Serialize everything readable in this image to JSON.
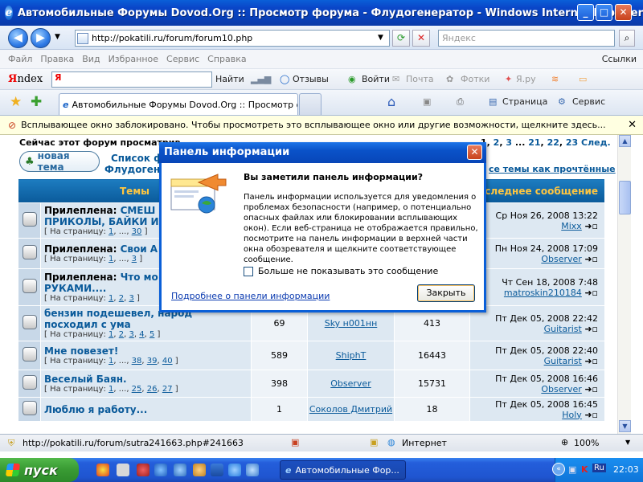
{
  "window": {
    "title": "Автомобильные Форумы Dovod.Org :: Просмотр форума - Флудогенератор - Windows Internet Explorer"
  },
  "address": {
    "url": "http://pokatili.ru/forum/forum10.php",
    "search_placeholder": "Яндекс"
  },
  "menu": {
    "items": [
      "Файл",
      "Правка",
      "Вид",
      "Избранное",
      "Сервис",
      "Справка"
    ],
    "right": "Ссылки"
  },
  "yandex": {
    "logo_a": "Я",
    "logo_b": "ndex",
    "find": "Найти",
    "reviews": "Отзывы",
    "login": "Войти",
    "mail": "Почта",
    "photos": "Фотки",
    "yaru": "Я.ру"
  },
  "favbar": {
    "tab_title": "Автомобильные Форумы Dovod.Org :: Просмотр фо...",
    "page": "Страница",
    "service": "Сервис"
  },
  "infobar": {
    "text": "Всплывающее окно заблокировано. Чтобы просмотреть это всплывающее окно или другие возможности, щелкните здесь..."
  },
  "forum": {
    "currently": "Сейчас этот форум просматрив",
    "pager_pre": "1, ",
    "pager_links": [
      "2",
      "3",
      "...",
      "21",
      "22",
      "23",
      "След."
    ],
    "new_topic": "новая тема",
    "links": [
      "Список ф",
      "Флудоген"
    ],
    "mark_all": "се темы как прочтённые",
    "headers": {
      "topics": "Темы",
      "last": "оследнее сообщение"
    },
    "rows": [
      {
        "prefix": "Прилеплена: ",
        "title": "СМЕШ",
        "title2": "ПРИКОЛЫ, БАЙКИ И Б",
        "pages_label": "На страницу: ",
        "pages": [
          "1",
          "...",
          "30"
        ],
        "replies": "",
        "author": "",
        "views": "",
        "date": "Ср Ноя 26, 2008 13:22",
        "last_user": "Mixx"
      },
      {
        "prefix": "Прилеплена: ",
        "title": "Свои А",
        "title2": "",
        "pages_label": "На страницу: ",
        "pages": [
          "1",
          "...",
          "3"
        ],
        "replies": "",
        "author": "",
        "views": "",
        "date": "Пн Ноя 24, 2008 17:09",
        "last_user": "Observer"
      },
      {
        "prefix": "Прилеплена: ",
        "title": "Что мо",
        "title2": "РУКАМИ....",
        "pages_label": "На страницу: ",
        "pages": [
          "1",
          "2",
          "3"
        ],
        "replies": "",
        "author": "",
        "views": "",
        "date": "Чт Сен 18, 2008 7:48",
        "last_user": "matroskin210184"
      },
      {
        "prefix": "",
        "title": "бензин подешевел, народ",
        "title2": "посходил с ума",
        "pages_label": "На страницу: ",
        "pages": [
          "1",
          "2",
          "3",
          "4",
          "5"
        ],
        "replies": "69",
        "author": "Sky н001нн",
        "views": "413",
        "date": "Пт Дек 05, 2008 22:42",
        "last_user": "Guitarist"
      },
      {
        "prefix": "",
        "title": "Мне повезет!",
        "title2": "",
        "pages_label": "На страницу: ",
        "pages": [
          "1",
          "...",
          "38",
          "39",
          "40"
        ],
        "replies": "589",
        "author": "ShiphT",
        "views": "16443",
        "date": "Пт Дек 05, 2008 22:40",
        "last_user": "Guitarist"
      },
      {
        "prefix": "",
        "title": "Веселый Баян.",
        "title2": "",
        "pages_label": "На страницу: ",
        "pages": [
          "1",
          "...",
          "25",
          "26",
          "27"
        ],
        "replies": "398",
        "author": "Observer",
        "views": "15731",
        "date": "Пт Дек 05, 2008 16:46",
        "last_user": "Observer"
      },
      {
        "prefix": "",
        "title": "Люблю я работу...",
        "title2": "",
        "pages_label": "",
        "pages": [],
        "replies": "1",
        "author": "Соколов Дмитрий",
        "views": "18",
        "date": "Пт Дек 05, 2008 16:45",
        "last_user": "Holy"
      }
    ]
  },
  "dialog": {
    "title": "Панель информации",
    "heading": "Вы заметили панель информации?",
    "body": "Панель информации используется для уведомления о проблемах безопасности (например, о потенциально опасных файлах или блокировании всплывающих окон). Если веб-страница не отображается правильно, посмотрите на панель информации в верхней части окна обозревателя и щелкните соответствующее сообщение.",
    "checkbox": "Больше не показывать это сообщение",
    "link": "Подробнее о панели информации",
    "close": "Закрыть"
  },
  "status": {
    "url": "http://pokatili.ru/forum/sutra241663.php#241663",
    "zone": "Интернет",
    "zoom": "100%"
  },
  "taskbar": {
    "start": "пуск",
    "task": "Автомобильные Фор...",
    "lang": "Ru",
    "time": "22:03"
  }
}
